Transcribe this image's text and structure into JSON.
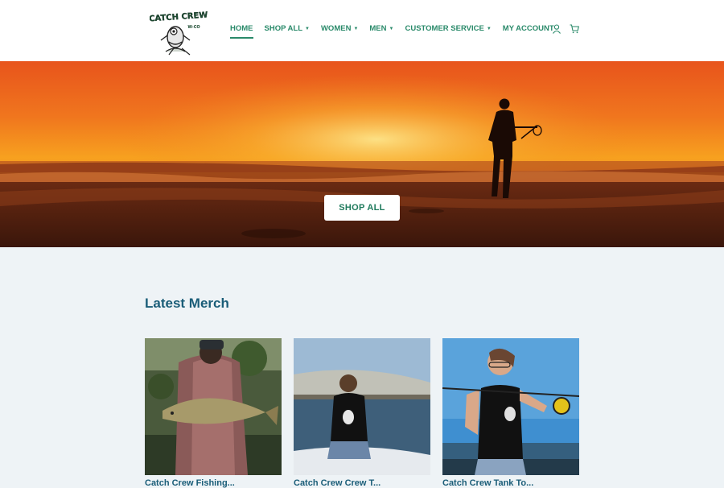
{
  "header": {
    "logo_text": "CATCH CREW",
    "logo_subtext": "W-CO",
    "nav": [
      {
        "label": "HOME",
        "has_dropdown": false,
        "active": true
      },
      {
        "label": "SHOP ALL",
        "has_dropdown": true,
        "active": false
      },
      {
        "label": "WOMEN",
        "has_dropdown": true,
        "active": false
      },
      {
        "label": "MEN",
        "has_dropdown": true,
        "active": false
      },
      {
        "label": "CUSTOMER SERVICE",
        "has_dropdown": true,
        "active": false
      },
      {
        "label": "MY ACCOUNT",
        "has_dropdown": false,
        "active": false
      }
    ],
    "icons": [
      "user-icon",
      "cart-icon"
    ]
  },
  "hero": {
    "button_label": "SHOP ALL"
  },
  "latest": {
    "title": "Latest Merch",
    "products": [
      {
        "title": "Catch Crew Fishing..."
      },
      {
        "title": "Catch Crew Crew T..."
      },
      {
        "title": "Catch Crew Tank To..."
      }
    ]
  },
  "colors": {
    "accent": "#2a8a6a",
    "heading": "#1a5d78",
    "page_bg": "#eef3f6"
  }
}
